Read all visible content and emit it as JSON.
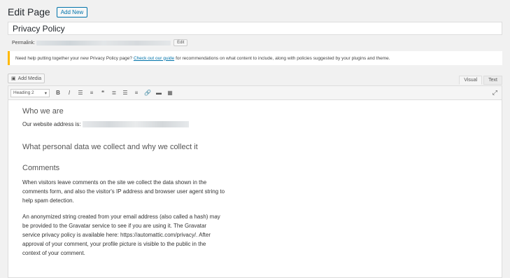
{
  "header": {
    "title": "Edit Page",
    "add_new": "Add New"
  },
  "post": {
    "title": "Privacy Policy",
    "permalink_label": "Permalink:",
    "edit_label": "Edit"
  },
  "notice": {
    "prefix": "Need help putting together your new Privacy Policy page?",
    "link": "Check out our guide",
    "suffix": "for recommendations on what content to include, along with policies suggested by your plugins and theme."
  },
  "editor": {
    "add_media": "Add Media",
    "tabs": {
      "visual": "Visual",
      "text": "Text"
    },
    "format_value": "Heading 2"
  },
  "content": {
    "h_who": "Who we are",
    "website_address_label": "Our website address is:",
    "h_personal": "What personal data we collect and why we collect it",
    "h_comments": "Comments",
    "p1": "When visitors leave comments on the site we collect the data shown in the comments form, and also the visitor's IP address and browser user agent string to help spam detection.",
    "p2": "An anonymized string created from your email address (also called a hash) may be provided to the Gravatar service to see if you are using it. The Gravatar service privacy policy is available here: https://automattic.com/privacy/. After approval of your comment, your profile picture is visible to the public in the context of your comment."
  },
  "colors": {
    "link": "#0073aa",
    "notice_border": "#ffb900"
  }
}
